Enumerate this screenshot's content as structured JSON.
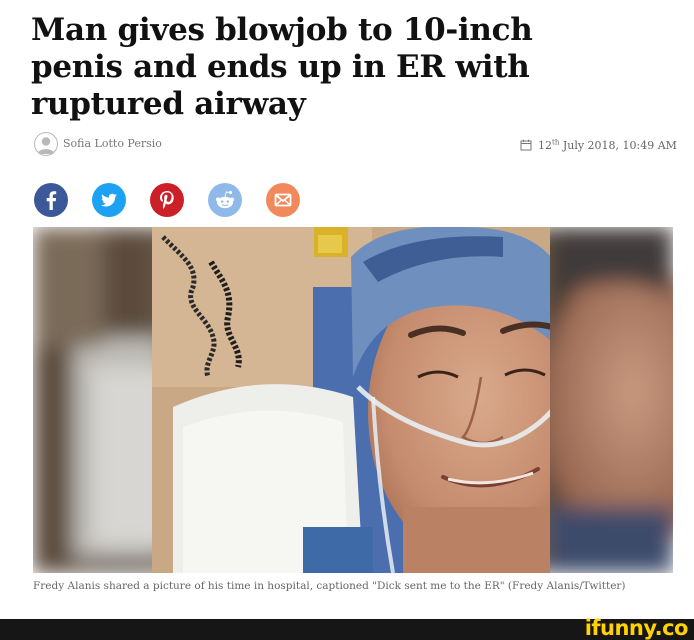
{
  "article": {
    "headline": "Man gives blowjob to 10-inch penis and ends up in ER with ruptured airway",
    "author": "Sofia Lotto Persio",
    "date_day": "12",
    "date_suffix": "th",
    "date_rest": " July 2018, 10:49 AM",
    "caption": "Fredy Alanis shared a picture of his time in hospital, captioned \"Dick sent me to the ER\" (Fredy Alanis/Twitter)"
  },
  "share": {
    "buttons": [
      {
        "icon": "facebook-icon",
        "color": "#3b5998"
      },
      {
        "icon": "twitter-icon",
        "color": "#1da1f2"
      },
      {
        "icon": "pinterest-icon",
        "color": "#cb2027"
      },
      {
        "icon": "reddit-icon",
        "color": "#8fb9e8"
      },
      {
        "icon": "email-icon",
        "color": "#f08a5d"
      }
    ]
  },
  "watermark": {
    "text": "ifunny.co",
    "color": "#ffd200"
  }
}
